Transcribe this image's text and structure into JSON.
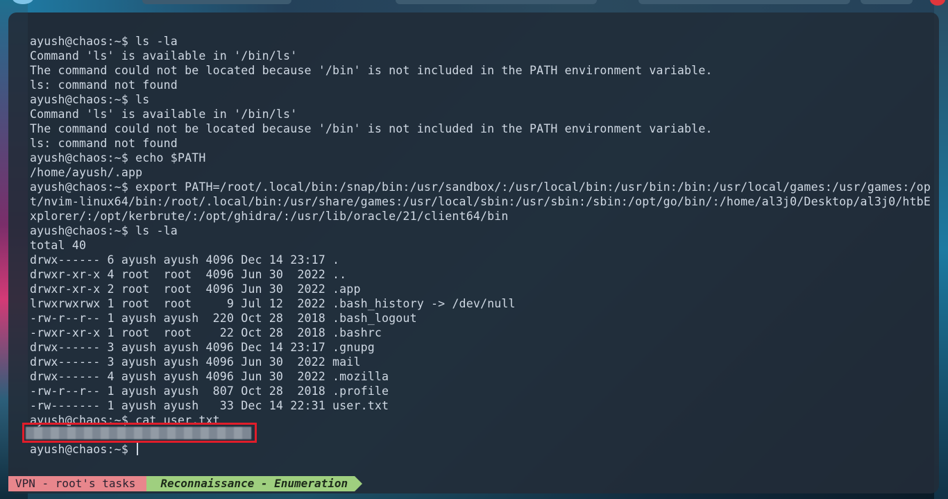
{
  "terminal": {
    "lines": [
      "ayush@chaos:~$ ls -la",
      "Command 'ls' is available in '/bin/ls'",
      "The command could not be located because '/bin' is not included in the PATH environment variable.",
      "ls: command not found",
      "ayush@chaos:~$ ls",
      "Command 'ls' is available in '/bin/ls'",
      "The command could not be located because '/bin' is not included in the PATH environment variable.",
      "ls: command not found",
      "ayush@chaos:~$ echo $PATH",
      "/home/ayush/.app",
      "ayush@chaos:~$ export PATH=/root/.local/bin:/snap/bin:/usr/sandbox/:/usr/local/bin:/usr/bin:/bin:/usr/local/games:/usr/games:/op",
      "t/nvim-linux64/bin:/root/.local/bin:/usr/share/games:/usr/local/sbin:/usr/sbin:/sbin:/opt/go/bin/:/home/al3j0/Desktop/al3j0/htbE",
      "xplorer/:/opt/kerbrute/:/opt/ghidra/:/usr/lib/oracle/21/client64/bin",
      "ayush@chaos:~$ ls -la",
      "total 40",
      "drwx------ 6 ayush ayush 4096 Dec 14 23:17 .",
      "drwxr-xr-x 4 root  root  4096 Jun 30  2022 ..",
      "drwxr-xr-x 2 root  root  4096 Jun 30  2022 .app",
      "lrwxrwxrwx 1 root  root     9 Jul 12  2022 .bash_history -> /dev/null",
      "-rw-r--r-- 1 ayush ayush  220 Oct 28  2018 .bash_logout",
      "-rwxr-xr-x 1 root  root    22 Oct 28  2018 .bashrc",
      "drwx------ 3 ayush ayush 4096 Dec 14 23:17 .gnupg",
      "drwx------ 3 ayush ayush 4096 Jun 30  2022 mail",
      "drwx------ 4 ayush ayush 4096 Jun 30  2022 .mozilla",
      "-rw-r--r-- 1 ayush ayush  807 Oct 28  2018 .profile",
      "-rw------- 1 ayush ayush   33 Dec 14 22:31 user.txt",
      "ayush@chaos:~$ cat user.txt",
      "",
      "ayush@chaos:~$ "
    ]
  },
  "statusbar": {
    "session": "VPN - root's tasks",
    "task": "Reconnaissance - Enumeration"
  },
  "colors": {
    "terminal_text": "#cfd8e3",
    "highlight_box": "#e11d2a",
    "segment_session": "#e8868c",
    "segment_task": "#9fcf7f"
  }
}
